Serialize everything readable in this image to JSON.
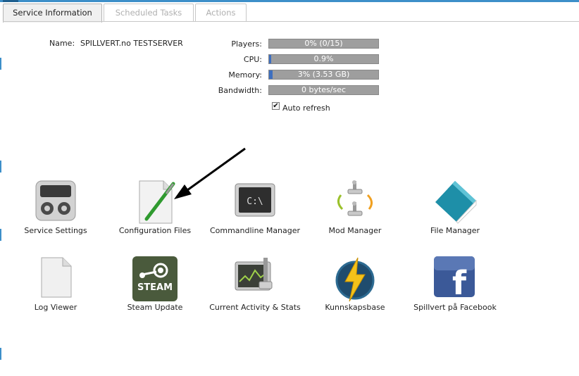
{
  "tabs": [
    {
      "label": "Service Information",
      "active": true
    },
    {
      "label": "Scheduled Tasks",
      "active": false
    },
    {
      "label": "Actions",
      "active": false
    }
  ],
  "service": {
    "name_label": "Name:",
    "name_value": "SPILLVERT.no TESTSERVER"
  },
  "stats": [
    {
      "label": "Players:",
      "text": "0% (0/15)",
      "percent": 0
    },
    {
      "label": "CPU:",
      "text": "0.9%",
      "percent": 0.9
    },
    {
      "label": "Memory:",
      "text": "3% (3.53 GB)",
      "percent": 3
    },
    {
      "label": "Bandwidth:",
      "text": "0 bytes/sec",
      "percent": 0
    }
  ],
  "auto_refresh": {
    "label": "Auto refresh",
    "checked": true
  },
  "tools": [
    {
      "label": "Service Settings",
      "icon": "service-settings-icon"
    },
    {
      "label": "Configuration Files",
      "icon": "configuration-files-icon"
    },
    {
      "label": "Commandline Manager",
      "icon": "commandline-icon",
      "glyph": "C:\\"
    },
    {
      "label": "Mod Manager",
      "icon": "mod-manager-icon"
    },
    {
      "label": "File Manager",
      "icon": "file-manager-icon"
    },
    {
      "label": "Log Viewer",
      "icon": "log-viewer-icon"
    },
    {
      "label": "Steam Update",
      "icon": "steam-icon",
      "glyph": "STEAM"
    },
    {
      "label": "Current Activity & Stats",
      "icon": "activity-stats-icon"
    },
    {
      "label": "Kunnskapsbase",
      "icon": "knowledge-base-icon"
    },
    {
      "label": "Spillvert på Facebook",
      "icon": "facebook-icon",
      "glyph": "f"
    }
  ],
  "colors": {
    "accent": "#3d8fc9",
    "bar_bg": "#9e9e9e",
    "bar_fill": "#3e6fbf",
    "steam": "#4a5a3c",
    "facebook": "#3b5998"
  }
}
